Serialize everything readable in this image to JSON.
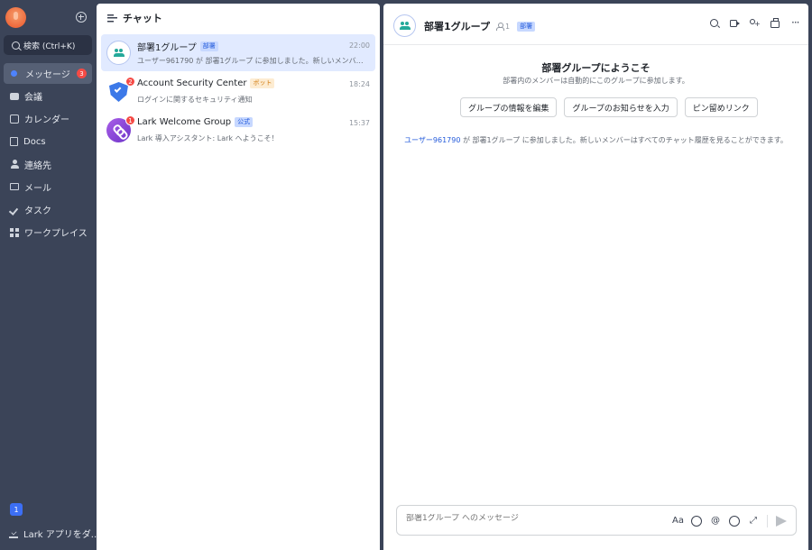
{
  "nav": {
    "search_label": "検索 (Ctrl+K)",
    "items": [
      {
        "label": "メッセージ",
        "icon": "message-icon",
        "badge": "3",
        "active": true
      },
      {
        "label": "会議",
        "icon": "video-meeting-icon"
      },
      {
        "label": "カレンダー",
        "icon": "calendar-icon"
      },
      {
        "label": "Docs",
        "icon": "docs-icon"
      },
      {
        "label": "連絡先",
        "icon": "contacts-icon"
      },
      {
        "label": "メール",
        "icon": "mail-icon"
      },
      {
        "label": "タスク",
        "icon": "task-icon"
      },
      {
        "label": "ワークプレイス",
        "icon": "workplace-icon"
      }
    ],
    "bottom_badge": "1",
    "download_label": "Lark アプリをダ..."
  },
  "chat_list": {
    "title": "チャット",
    "chats": [
      {
        "name": "部署1グループ",
        "tag": "部署",
        "time": "22:00",
        "preview": "ユーザー961790 が 部署1グループ に参加しました。新しいメンバーはすべてのチャット履歴を見ることができます。",
        "selected": true
      },
      {
        "name": "Account Security Center",
        "tag": "ボット",
        "time": "18:24",
        "preview": "ログインに関するセキュリティ通知",
        "badge": "2"
      },
      {
        "name": "Lark Welcome Group",
        "tag": "公式",
        "time": "15:37",
        "preview": "Lark 導入アシスタント: Lark へようこそ！",
        "badge": "1"
      }
    ]
  },
  "conversation": {
    "title": "部署1グループ",
    "member_count": "1",
    "tag": "部署",
    "welcome_title": "部署グループにようこそ",
    "welcome_subtitle": "部署内のメンバーは自動的にこのグループに参加します。",
    "actions": [
      "グループの情報を編集",
      "グループのお知らせを入力",
      "ピン留めリンク"
    ],
    "system_message": {
      "user": "ユーザー961790",
      "text": " が 部署1グループ に参加しました。新しいメンバーはすべてのチャット履歴を見ることができます。"
    },
    "composer_placeholder": "部署1グループ へのメッセージ",
    "composer_format_label": "Aa"
  },
  "colors": {
    "sidebar_bg": "#3b4458",
    "accent": "#4e83fd",
    "selected_bg": "#e1eaff",
    "badge_red": "#f54a45",
    "link_blue": "#245bdb"
  }
}
